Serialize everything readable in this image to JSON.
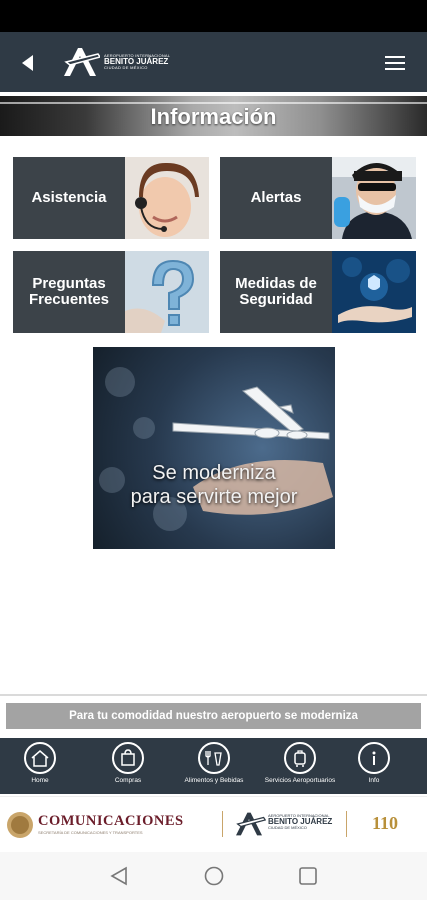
{
  "header": {
    "logo_line1": "AEROPUERTO INTERNACIONAL",
    "logo_line2": "BENITO JUÁREZ",
    "logo_line3": "CIUDAD DE MÉXICO",
    "back_icon": "back-arrow-icon",
    "menu_icon": "hamburger-menu-icon"
  },
  "banner": {
    "title": "Información"
  },
  "tiles": [
    {
      "label": "Asistencia"
    },
    {
      "label": "Alertas"
    },
    {
      "label": "Preguntas Frecuentes"
    },
    {
      "label": "Medidas de Seguridad"
    }
  ],
  "promo": {
    "line1": "Se moderniza",
    "line2": "para servirte mejor"
  },
  "notice": {
    "text": "Para tu comodidad nuestro aeropuerto se moderniza"
  },
  "bottom_nav": [
    {
      "label": "Home",
      "icon": "home-icon"
    },
    {
      "label": "Compras",
      "icon": "shopping-bag-icon"
    },
    {
      "label": "Alimentos y Bebidas",
      "icon": "food-drink-icon"
    },
    {
      "label": "Servicios Aeroportuarios",
      "icon": "luggage-icon"
    },
    {
      "label": "Info",
      "icon": "info-icon"
    }
  ],
  "footer": {
    "brand": "COMUNICACIONES",
    "brand_sub": "SECRETARÍA DE COMUNICACIONES Y TRANSPORTES",
    "airport_line1": "AEROPUERTO INTERNACIONAL",
    "airport_line2": "BENITO JUÁREZ",
    "airport_line3": "CIUDAD DE MÉXICO",
    "anniv": "110"
  },
  "colors": {
    "header_bg": "#2f3a45",
    "notice_bg": "#a3a3a3",
    "tile_bg": "#3c4349"
  }
}
